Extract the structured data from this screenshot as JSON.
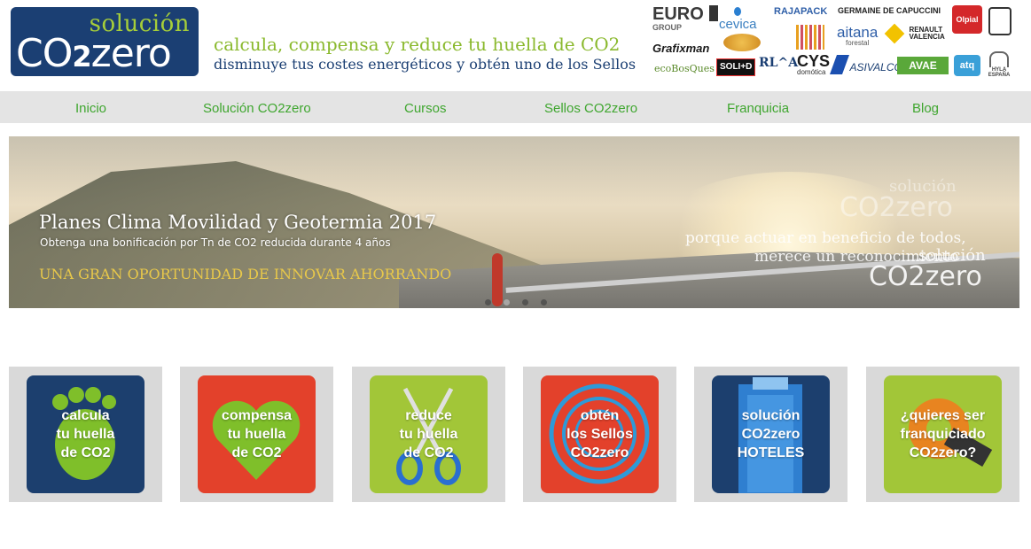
{
  "header": {
    "logo_top": "solución",
    "logo_co": "CO",
    "logo_two": "2",
    "logo_zero": "zero",
    "slogan_line1": "calcula, compensa y reduce tu huella de CO2",
    "slogan_line2": "disminuye tus costes energéticos y obtén uno de los Sellos"
  },
  "sponsors": {
    "euro": "EURO",
    "group": "GROUP",
    "cevica": "cevica",
    "rajapack": "RAJAPACK",
    "germaine": "GERMAINE DE CAPUCCINI",
    "olpial": "Olpial",
    "grafixman": "Grafixman",
    "aitana": "aitana",
    "forestal": "forestal",
    "renault": "RENAULT VALENCIA",
    "ecobosques": "ecoBosQues",
    "solid": "SOLI+D",
    "rla": "RL^A",
    "cys": "CYS",
    "domotica": "domótica",
    "asivalco": "ASIVALCO",
    "avae": "AVAE",
    "atq": "atq",
    "hyla": "HYLA ESPAÑA"
  },
  "nav": {
    "items": [
      "Inicio",
      "Solución CO2zero",
      "Cursos",
      "Sellos CO2zero",
      "Franquicia",
      "Blog"
    ]
  },
  "hero": {
    "title": "Planes Clima Movilidad y Geotermia 2017",
    "subtitle": "Obtenga una bonificación por Tn de CO2 reducida durante 4 años",
    "cta": "UNA GRAN OPORTUNIDAD DE INNOVAR AHORRANDO",
    "right_line1": "porque actuar en beneficio de todos,",
    "right_line2": "merece un reconocimiento",
    "watermark_top": "solución",
    "watermark_bottom": "CO2zero",
    "slide_count": 4,
    "active_slide": 2
  },
  "tiles": [
    {
      "label": "calcula\ntu huella\nde CO2",
      "bg": "#1c3f6e"
    },
    {
      "label": "compensa\ntu huella\nde CO2",
      "bg": "#e3412b"
    },
    {
      "label": "reduce\ntu huella\nde CO2",
      "bg": "#a2c638"
    },
    {
      "label": "obtén\nlos Sellos\nCO2zero",
      "bg": "#e3412b"
    },
    {
      "label": "solución\nCO2zero\nHOTELES",
      "bg": "#1c3f6e"
    },
    {
      "label": "¿quieres ser\nfranquiciado\nCO2zero?",
      "bg": "#a2c638"
    }
  ],
  "colors": {
    "brand_navy": "#1b3f73",
    "brand_green": "#8ab92d",
    "nav_text": "#3fa62f",
    "nav_bg": "#e4e4e4",
    "tile_bg": "#d9d9d9"
  }
}
